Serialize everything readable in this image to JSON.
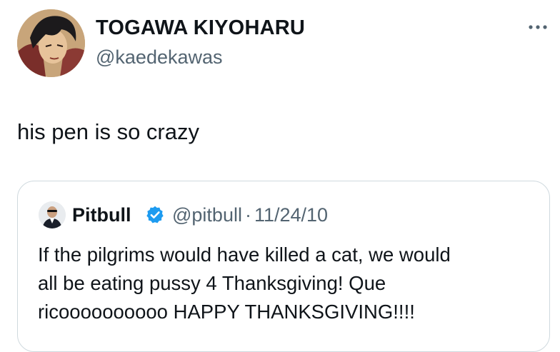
{
  "author": {
    "display_name": "TOGAWA KIYOHARU",
    "handle": "@kaedekawas"
  },
  "tweet": {
    "text": "his pen is so crazy"
  },
  "quoted_tweet": {
    "display_name": "Pitbull",
    "handle": "@pitbull",
    "separator": "·",
    "date": "11/24/10",
    "text_lines": [
      "If the pilgrims would have killed a cat, we would",
      "all be eating pussy 4 Thanksgiving!  Que",
      "ricoooooooooo HAPPY THANKSGIVING!!!!"
    ]
  },
  "colors": {
    "text_primary": "#0f1419",
    "text_secondary": "#536471",
    "verified_blue": "#1d9bf0",
    "card_border": "#cfd9de"
  },
  "icons": {
    "more": "more-dots-icon",
    "verified": "verified-badge-icon"
  }
}
